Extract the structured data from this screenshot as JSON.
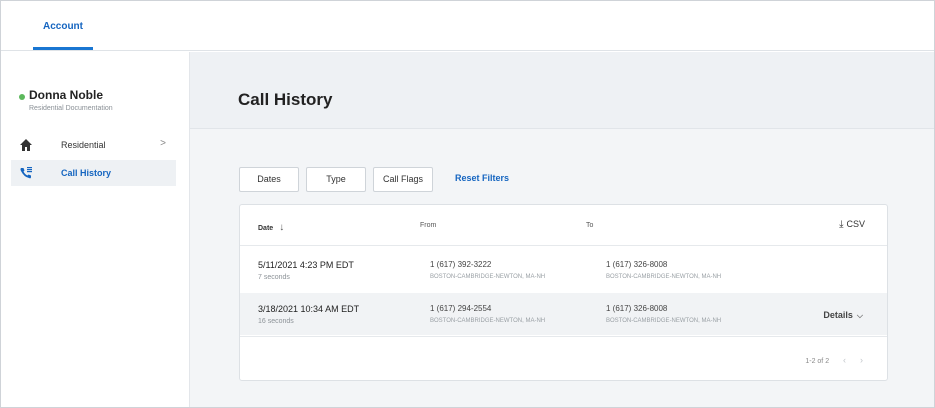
{
  "topnav": {
    "tabs": [
      {
        "label": "Account",
        "active": true
      }
    ]
  },
  "user": {
    "name": "Donna Noble",
    "subtitle": "Residential Documentation",
    "status_color": "#5cb85c"
  },
  "sidebar": {
    "items": [
      {
        "label": "Residential",
        "icon": "home-icon",
        "has_chevron": true,
        "chevron": ">"
      },
      {
        "label": "Call History",
        "icon": "phone-history-icon",
        "active": true
      }
    ]
  },
  "main": {
    "title": "Call History"
  },
  "filters": {
    "buttons": [
      "Dates",
      "Type",
      "Call Flags"
    ],
    "reset_label": "Reset Filters"
  },
  "table": {
    "columns": {
      "date": "Date",
      "from": "From",
      "to": "To"
    },
    "sort_icon": "arrow-down-icon",
    "csv_label": "CSV",
    "rows": [
      {
        "date": "5/11/2021 4:23 PM EDT",
        "duration": "7 seconds",
        "from_number": "1 (617) 392-3222",
        "from_location": "BOSTON-CAMBRIDGE-NEWTON, MA-NH",
        "to_number": "1 (617) 326-8008",
        "to_location": "BOSTON-CAMBRIDGE-NEWTON, MA-NH",
        "details_label": ""
      },
      {
        "date": "3/18/2021 10:34 AM EDT",
        "duration": "16 seconds",
        "from_number": "1 (617) 294-2554",
        "from_location": "BOSTON-CAMBRIDGE-NEWTON, MA-NH",
        "to_number": "1 (617) 326-8008",
        "to_location": "BOSTON-CAMBRIDGE-NEWTON, MA-NH",
        "details_label": "Details"
      }
    ],
    "pagination": "1-2 of 2"
  },
  "colors": {
    "accent": "#1565c0",
    "status_dot": "#5cb85c"
  }
}
